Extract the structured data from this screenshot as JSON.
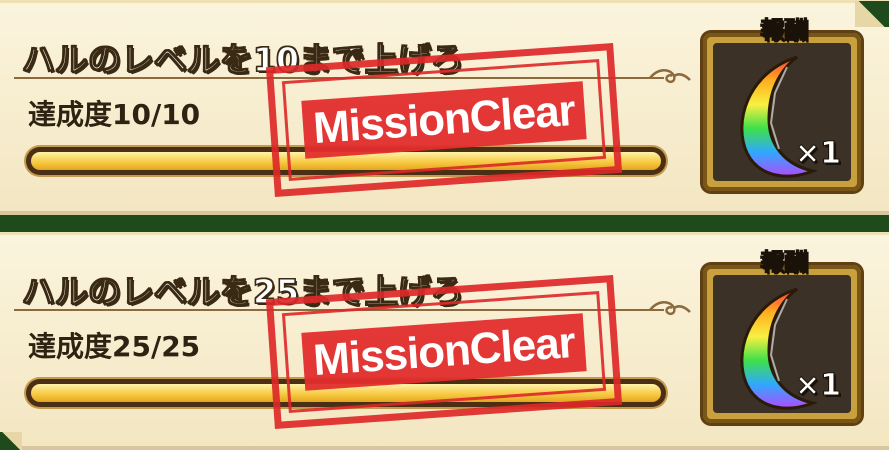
{
  "missions": [
    {
      "title": "ハルのレベルを10まで上げろ",
      "progress_label": "達成度10/10",
      "progress_current": 10,
      "progress_max": 10,
      "stamp_text": "MissionClear",
      "reward_tag": "報酬",
      "reward_quantity": "×1",
      "reward_icon": "rainbow-crescent-gem-icon"
    },
    {
      "title": "ハルのレベルを25まで上げろ",
      "progress_label": "達成度25/25",
      "progress_current": 25,
      "progress_max": 25,
      "stamp_text": "MissionClear",
      "reward_tag": "報酬",
      "reward_quantity": "×1",
      "reward_icon": "rainbow-crescent-gem-icon"
    }
  ],
  "colors": {
    "stamp_red": "#e02d2d",
    "bar_gold": "#f6c73c",
    "frame_gold": "#c9a03e",
    "background_green": "#1f4a1c"
  }
}
